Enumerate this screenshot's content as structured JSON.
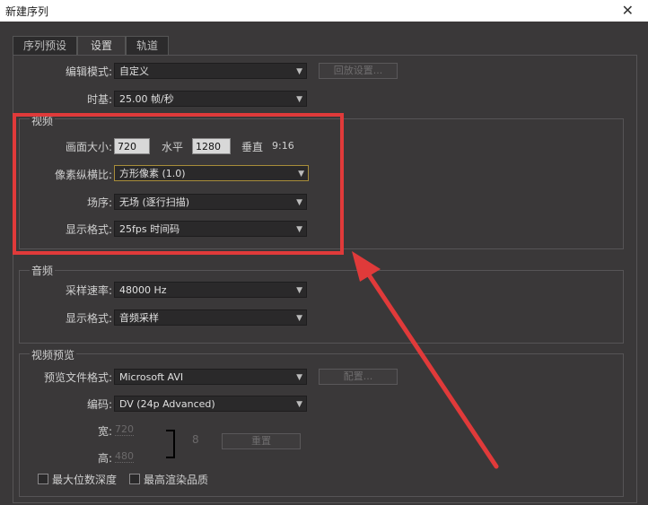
{
  "window": {
    "title": "新建序列",
    "close": "✕"
  },
  "tabs": [
    {
      "label": "序列预设"
    },
    {
      "label": "设置"
    },
    {
      "label": "轨道"
    }
  ],
  "edit_mode": {
    "label": "编辑模式:",
    "value": "自定义",
    "button": "回放设置..."
  },
  "timebase": {
    "label": "时基:",
    "value": "25.00 帧/秒"
  },
  "video": {
    "title": "视频",
    "frame_size": {
      "label": "画面大小:",
      "width": "720",
      "h_label": "水平",
      "height": "1280",
      "v_label": "垂直",
      "ratio": "9:16"
    },
    "pixel_aspect": {
      "label": "像素纵横比:",
      "value": "方形像素 (1.0)"
    },
    "fields": {
      "label": "场序:",
      "value": "无场 (逐行扫描)"
    },
    "display": {
      "label": "显示格式:",
      "value": "25fps 时间码"
    }
  },
  "audio": {
    "title": "音频",
    "sample_rate": {
      "label": "采样速率:",
      "value": "48000 Hz"
    },
    "display": {
      "label": "显示格式:",
      "value": "音频采样"
    }
  },
  "preview": {
    "title": "视频预览",
    "file_format": {
      "label": "预览文件格式:",
      "value": "Microsoft AVI",
      "button": "配置..."
    },
    "codec": {
      "label": "编码:",
      "value": "DV (24p Advanced)"
    },
    "width": {
      "label": "宽:",
      "value": "720"
    },
    "height": {
      "label": "高:",
      "value": "480"
    },
    "reset": "重置",
    "max_bit_depth": "最大位数深度",
    "max_render_quality": "最高渲染品质"
  },
  "colors": {
    "annotation": "#e03a3a",
    "background": "#3a3839"
  }
}
